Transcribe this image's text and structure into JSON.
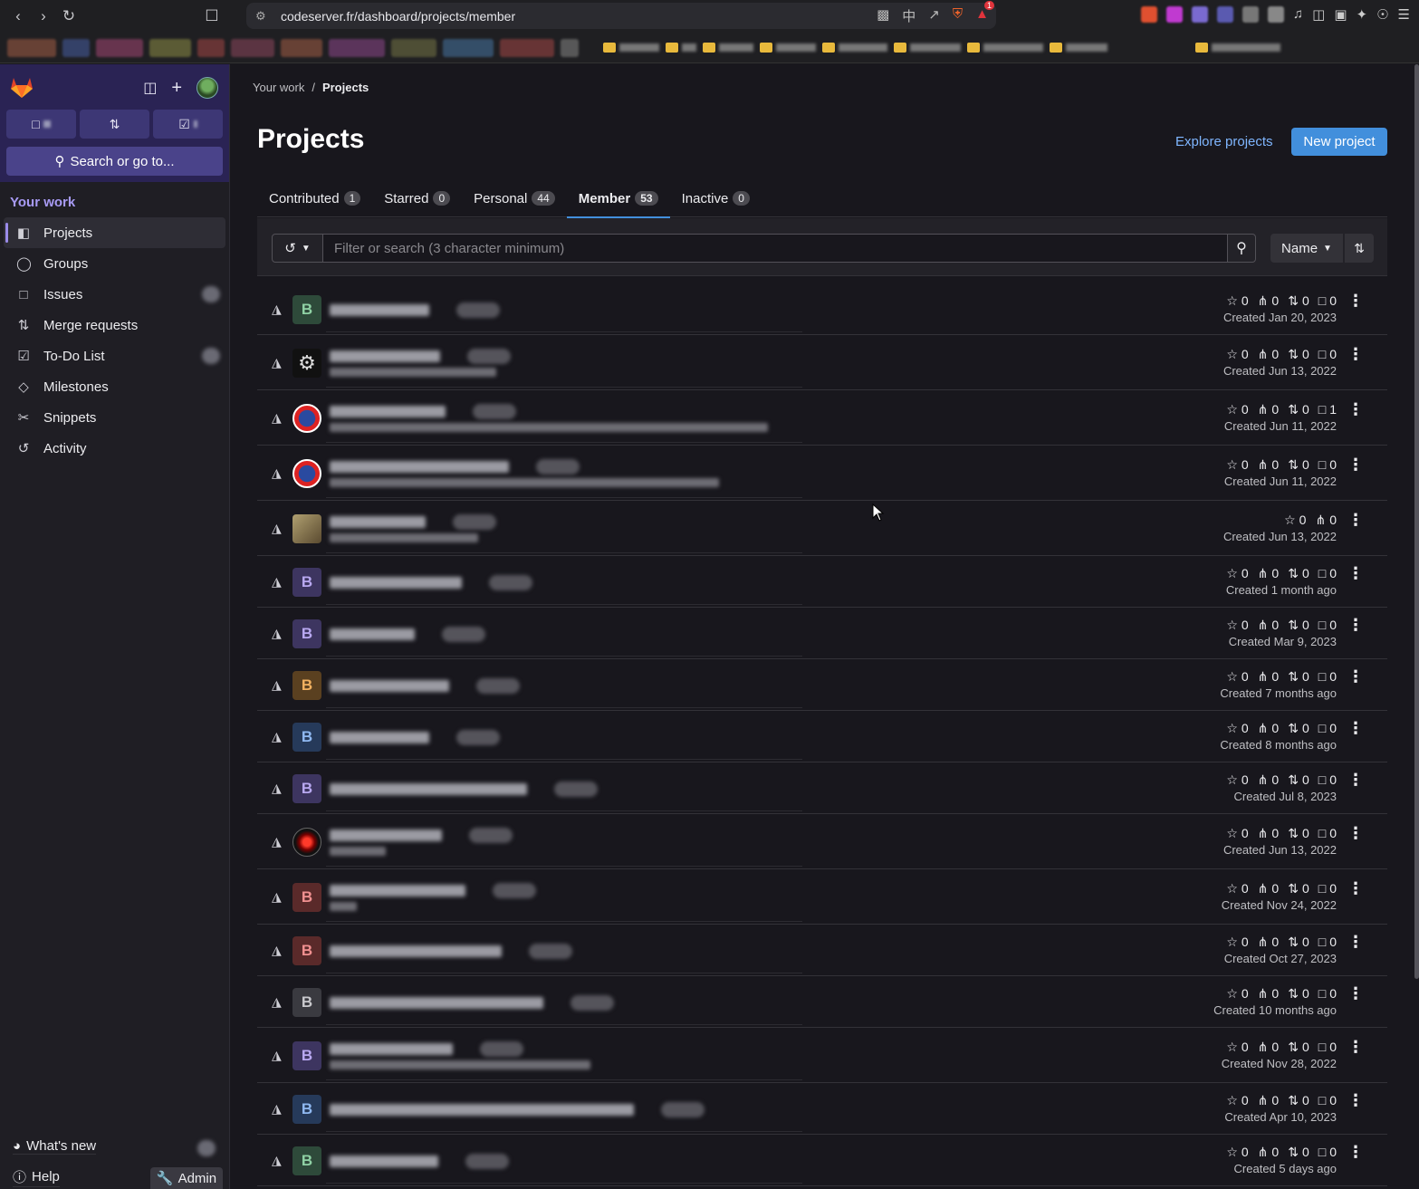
{
  "browser": {
    "url": "codeserver.fr/dashboard/projects/member",
    "alert_badge": "1"
  },
  "sidebar": {
    "search_label": "Search or go to...",
    "section_title": "Your work",
    "items": [
      {
        "label": "Projects",
        "icon": "project-icon"
      },
      {
        "label": "Groups",
        "icon": "group-icon"
      },
      {
        "label": "Issues",
        "icon": "issues-icon"
      },
      {
        "label": "Merge requests",
        "icon": "merge-request-icon"
      },
      {
        "label": "To-Do List",
        "icon": "todo-icon"
      },
      {
        "label": "Milestones",
        "icon": "milestone-icon"
      },
      {
        "label": "Snippets",
        "icon": "snippet-icon"
      },
      {
        "label": "Activity",
        "icon": "activity-icon"
      }
    ],
    "whats_new": "What's new",
    "help": "Help",
    "admin": "Admin"
  },
  "breadcrumb": {
    "parent": "Your work",
    "current": "Projects"
  },
  "header": {
    "title": "Projects",
    "explore_label": "Explore projects",
    "new_project_label": "New project"
  },
  "tabs": [
    {
      "label": "Contributed",
      "count": "1"
    },
    {
      "label": "Starred",
      "count": "0"
    },
    {
      "label": "Personal",
      "count": "44"
    },
    {
      "label": "Member",
      "count": "53"
    },
    {
      "label": "Inactive",
      "count": "0"
    }
  ],
  "filter": {
    "placeholder": "Filter or search (3 character minimum)",
    "sort_label": "Name"
  },
  "projects": [
    {
      "avatar": "B",
      "avatar_color": "#2e4a3a",
      "avatar_text": "#8fd1a4",
      "stars": "0",
      "forks": "0",
      "mrs": "0",
      "issues": "0",
      "created": "Created Jan 20, 2023",
      "desc": false,
      "show_mr": true
    },
    {
      "avatar": "gear",
      "avatar_color": "#111",
      "avatar_text": "#ccc",
      "stars": "0",
      "forks": "0",
      "mrs": "0",
      "issues": "0",
      "created": "Created Jun 13, 2022",
      "desc": true,
      "show_mr": true
    },
    {
      "avatar": "uefa",
      "avatar_color": "#d22",
      "avatar_text": "#fff",
      "stars": "0",
      "forks": "0",
      "mrs": "0",
      "issues": "1",
      "created": "Created Jun 11, 2022",
      "desc": true,
      "show_mr": true
    },
    {
      "avatar": "uefa",
      "avatar_color": "#d22",
      "avatar_text": "#fff",
      "stars": "0",
      "forks": "0",
      "mrs": "0",
      "issues": "0",
      "created": "Created Jun 11, 2022",
      "desc": true,
      "show_mr": true
    },
    {
      "avatar": "photo",
      "avatar_color": "#8a7a55",
      "avatar_text": "#fff",
      "stars": "0",
      "forks": "0",
      "mrs": "",
      "issues": "",
      "created": "Created Jun 13, 2022",
      "desc": true,
      "show_mr": false
    },
    {
      "avatar": "B",
      "avatar_color": "#3d3560",
      "avatar_text": "#b8a8f0",
      "stars": "0",
      "forks": "0",
      "mrs": "0",
      "issues": "0",
      "created": "Created 1 month ago",
      "desc": false,
      "show_mr": true
    },
    {
      "avatar": "B",
      "avatar_color": "#3d3560",
      "avatar_text": "#b8a8f0",
      "stars": "0",
      "forks": "0",
      "mrs": "0",
      "issues": "0",
      "created": "Created Mar 9, 2023",
      "desc": false,
      "show_mr": true
    },
    {
      "avatar": "B",
      "avatar_color": "#5a4020",
      "avatar_text": "#f0b060",
      "stars": "0",
      "forks": "0",
      "mrs": "0",
      "issues": "0",
      "created": "Created 7 months ago",
      "desc": false,
      "show_mr": true
    },
    {
      "avatar": "B",
      "avatar_color": "#263a5a",
      "avatar_text": "#8fb8f0",
      "stars": "0",
      "forks": "0",
      "mrs": "0",
      "issues": "0",
      "created": "Created 8 months ago",
      "desc": false,
      "show_mr": true
    },
    {
      "avatar": "B",
      "avatar_color": "#3d3560",
      "avatar_text": "#b8a8f0",
      "stars": "0",
      "forks": "0",
      "mrs": "0",
      "issues": "0",
      "created": "Created Jul 8, 2023",
      "desc": false,
      "show_mr": true
    },
    {
      "avatar": "hal",
      "avatar_color": "#000",
      "avatar_text": "#f33",
      "stars": "0",
      "forks": "0",
      "mrs": "0",
      "issues": "0",
      "created": "Created Jun 13, 2022",
      "desc": true,
      "show_mr": true
    },
    {
      "avatar": "B",
      "avatar_color": "#5a2a2a",
      "avatar_text": "#f09090",
      "stars": "0",
      "forks": "0",
      "mrs": "0",
      "issues": "0",
      "created": "Created Nov 24, 2022",
      "desc": true,
      "show_mr": true
    },
    {
      "avatar": "B",
      "avatar_color": "#5a2a2a",
      "avatar_text": "#f09090",
      "stars": "0",
      "forks": "0",
      "mrs": "0",
      "issues": "0",
      "created": "Created Oct 27, 2023",
      "desc": false,
      "show_mr": true
    },
    {
      "avatar": "B",
      "avatar_color": "#3a3a40",
      "avatar_text": "#c8c8cc",
      "stars": "0",
      "forks": "0",
      "mrs": "0",
      "issues": "0",
      "created": "Created 10 months ago",
      "desc": false,
      "show_mr": true
    },
    {
      "avatar": "B",
      "avatar_color": "#3d3560",
      "avatar_text": "#b8a8f0",
      "stars": "0",
      "forks": "0",
      "mrs": "0",
      "issues": "0",
      "created": "Created Nov 28, 2022",
      "desc": true,
      "show_mr": true
    },
    {
      "avatar": "B",
      "avatar_color": "#263a5a",
      "avatar_text": "#8fb8f0",
      "stars": "0",
      "forks": "0",
      "mrs": "0",
      "issues": "0",
      "created": "Created Apr 10, 2023",
      "desc": false,
      "show_mr": true
    },
    {
      "avatar": "B",
      "avatar_color": "#2e4a3a",
      "avatar_text": "#8fd1a4",
      "stars": "0",
      "forks": "0",
      "mrs": "0",
      "issues": "0",
      "created": "Created 5 days ago",
      "desc": false,
      "show_mr": true
    }
  ]
}
